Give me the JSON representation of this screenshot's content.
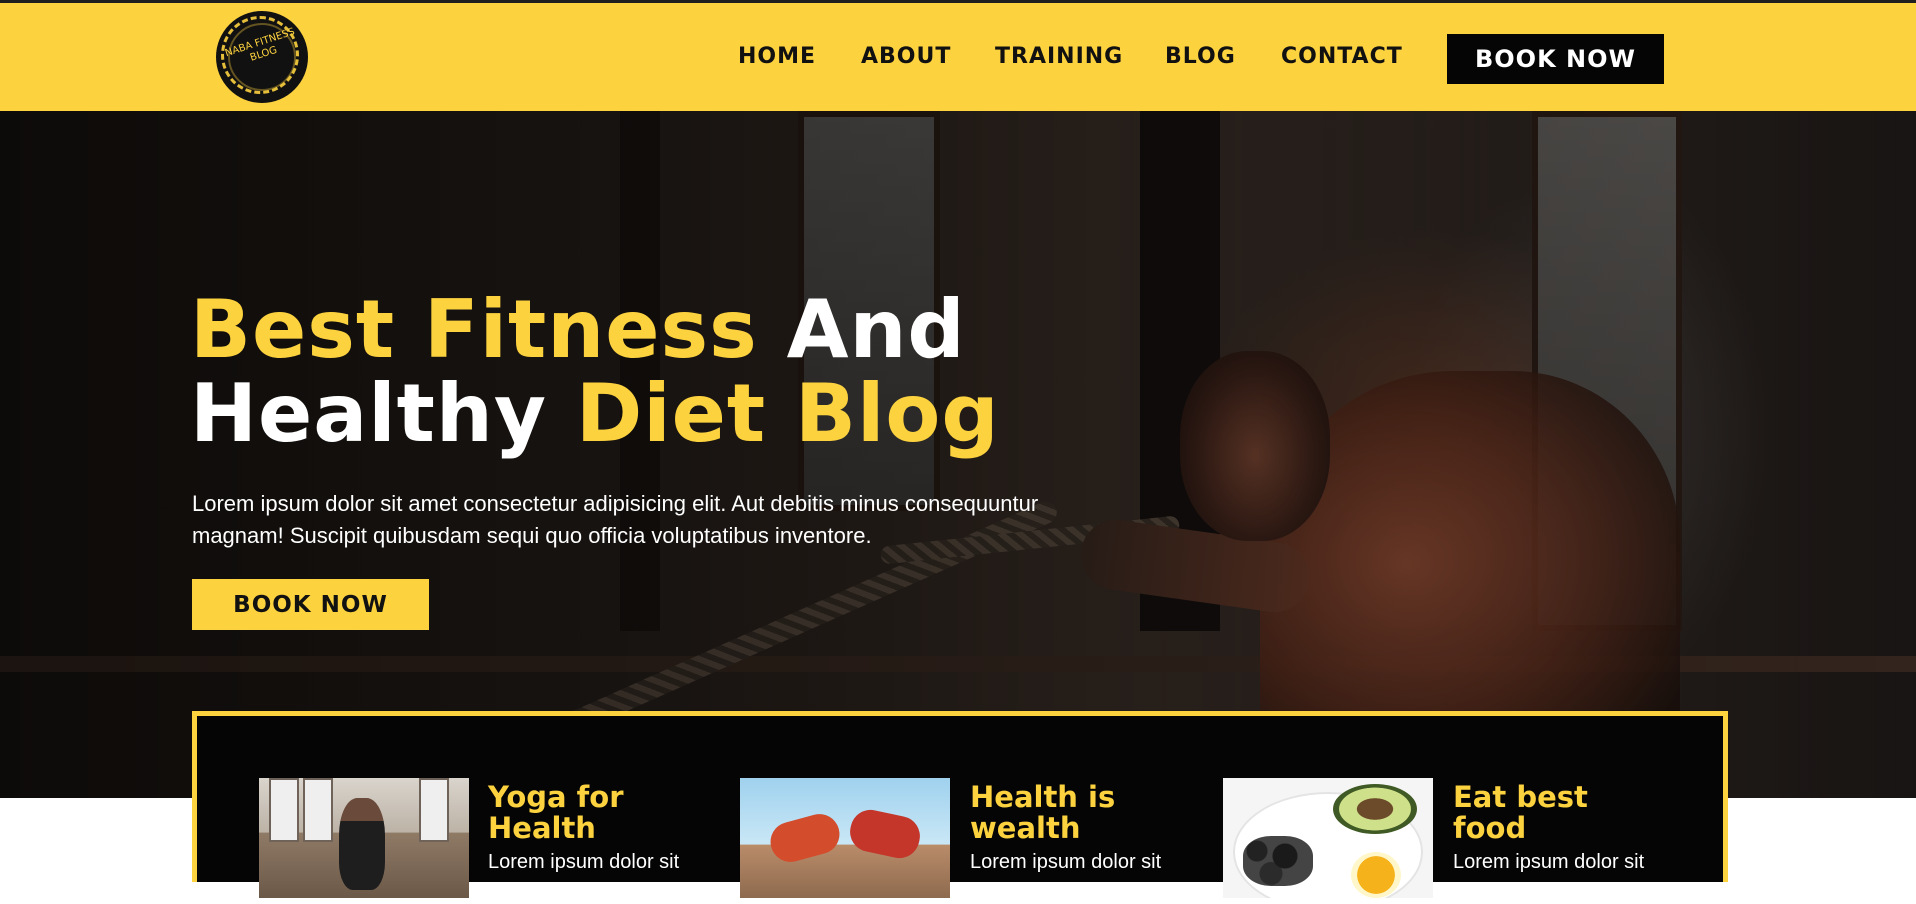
{
  "header": {
    "logo_text": "NABA FITNESS BLOG",
    "nav": [
      "HOME",
      "ABOUT",
      "TRAINING",
      "BLOG",
      "CONTACT"
    ],
    "book_label": "BOOK NOW"
  },
  "hero": {
    "title_part1": "Best Fitness",
    "title_part2": "And",
    "title_part3": "Healthy",
    "title_part4": "Diet Blog",
    "description": "Lorem ipsum dolor sit amet consectetur adipisicing elit. Aut debitis minus consequuntur magnam! Suscipit quibusdam sequi quo officia voluptatibus inventore.",
    "book_label": "BOOK NOW"
  },
  "features": [
    {
      "title": "Yoga for Health",
      "text": "Lorem ipsum dolor sit amet consectetur"
    },
    {
      "title": "Health is wealth",
      "text": "Lorem ipsum dolor sit amet consectetur"
    },
    {
      "title": "Eat best food",
      "text": "Lorem ipsum dolor sit amet consectetur"
    }
  ],
  "colors": {
    "accent": "#fdd23f",
    "dark": "#050505",
    "text_light": "#ffffff"
  }
}
